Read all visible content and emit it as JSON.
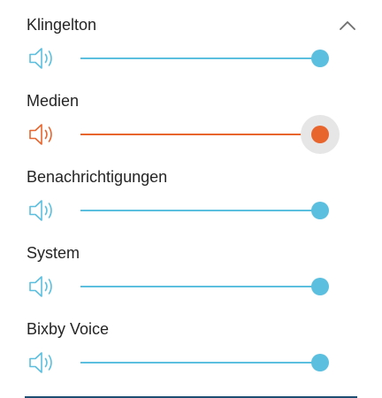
{
  "panel": {
    "collapse_icon": "chevron-up-icon"
  },
  "sliders": [
    {
      "label": "Klingelton",
      "level": 1.0,
      "color": "#5bbfdf",
      "active": false,
      "icon": "volume-speaker-icon"
    },
    {
      "label": "Medien",
      "level": 1.0,
      "color": "#e8652e",
      "active": true,
      "icon": "volume-speaker-icon"
    },
    {
      "label": "Benachrichtigungen",
      "level": 1.0,
      "color": "#5bbfdf",
      "active": false,
      "icon": "volume-speaker-icon"
    },
    {
      "label": "System",
      "level": 1.0,
      "color": "#5bbfdf",
      "active": false,
      "icon": "volume-speaker-icon"
    },
    {
      "label": "Bixby Voice",
      "level": 1.0,
      "color": "#5bbfdf",
      "active": false,
      "icon": "volume-speaker-icon"
    }
  ],
  "colors": {
    "track_inactive": "#d8d8d8",
    "halo": "#e6e6e6",
    "label_text": "#252525"
  }
}
